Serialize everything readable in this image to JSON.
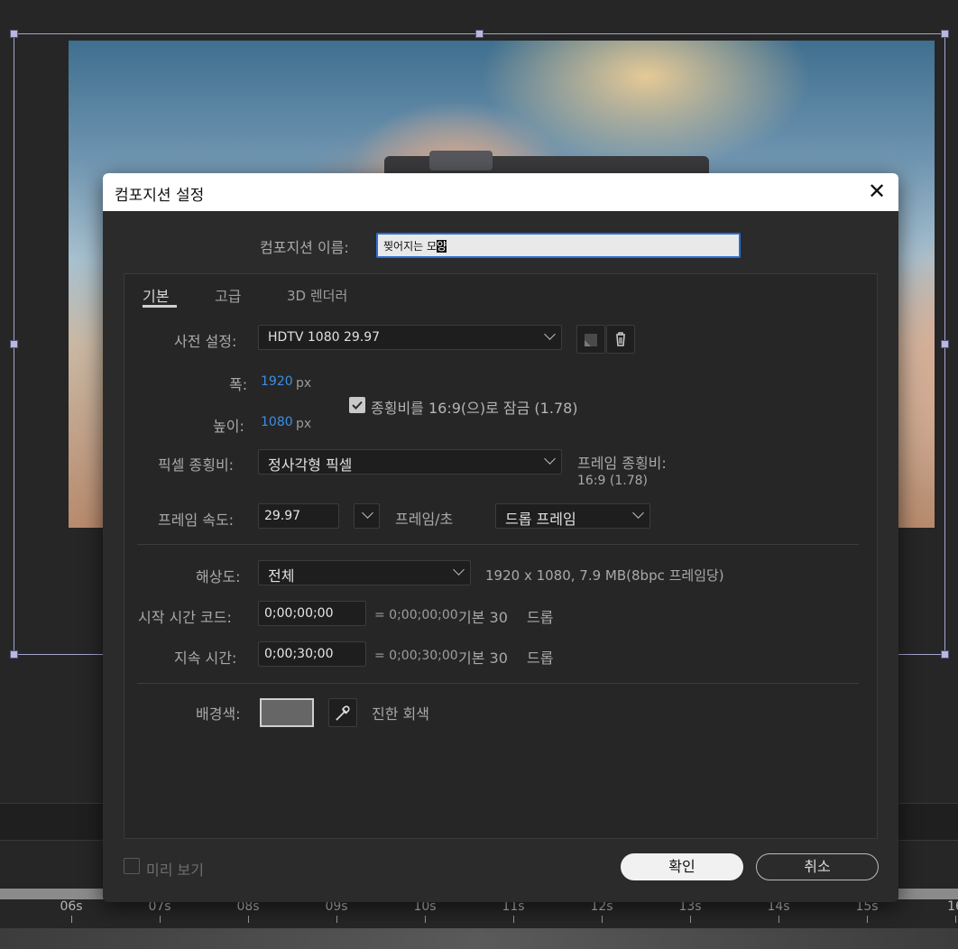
{
  "dialog": {
    "title": "컴포지션 설정",
    "close_icon": "close-icon",
    "name_label": "컴포지션 이름:",
    "name_value_plain": "찢어지는 모",
    "name_value_selected": "양",
    "tabs": [
      "기본",
      "고급",
      "3D 렌더러"
    ],
    "preset_label": "사전 설정:",
    "preset_value": "HDTV 1080 29.97",
    "width_label": "폭:",
    "width_value": "1920",
    "height_label": "높이:",
    "height_value": "1080",
    "px_unit": "px",
    "lock_aspect_label": "종횡비를 16:9(으)로 잠금 (1.78)",
    "lock_aspect_checked": true,
    "pixel_aspect_label": "픽셀 종횡비:",
    "pixel_aspect_value": "정사각형 픽셀",
    "frame_aspect_label": "프레임 종횡비:",
    "frame_aspect_value": "16:9 (1.78)",
    "frame_rate_label": "프레임 속도:",
    "frame_rate_value": "29.97",
    "frame_rate_unit": "프레임/초",
    "drop_frame_value": "드롭 프레임",
    "resolution_label": "해상도:",
    "resolution_value": "전체",
    "resolution_info": "1920 x 1080, 7.9 MB(8bpc 프레임당)",
    "start_tc_label": "시작 시간 코드:",
    "start_tc_value": "0;00;00;00",
    "start_tc_info": "= 0;00;00;00",
    "duration_label": "지속 시간:",
    "duration_value": "0;00;30;00",
    "duration_info": "= 0;00;30;00",
    "base_label": "기본 30",
    "drop_label": "드롭",
    "bg_color_label": "배경색:",
    "bg_color_name": "진한 회색",
    "bg_color_hex": "#666666",
    "preview_label": "미리 보기",
    "preview_checked": false,
    "ok_label": "확인",
    "cancel_label": "취소"
  },
  "timeline": {
    "ticks": [
      "06s",
      "07s",
      "08s",
      "09s",
      "10s",
      "11s",
      "12s",
      "13s",
      "14s",
      "15s",
      "16"
    ]
  },
  "colors": {
    "accent_blue": "#3b8fe6",
    "focus_border": "#2d6fd6",
    "bounding_box": "#a5a5d0"
  }
}
